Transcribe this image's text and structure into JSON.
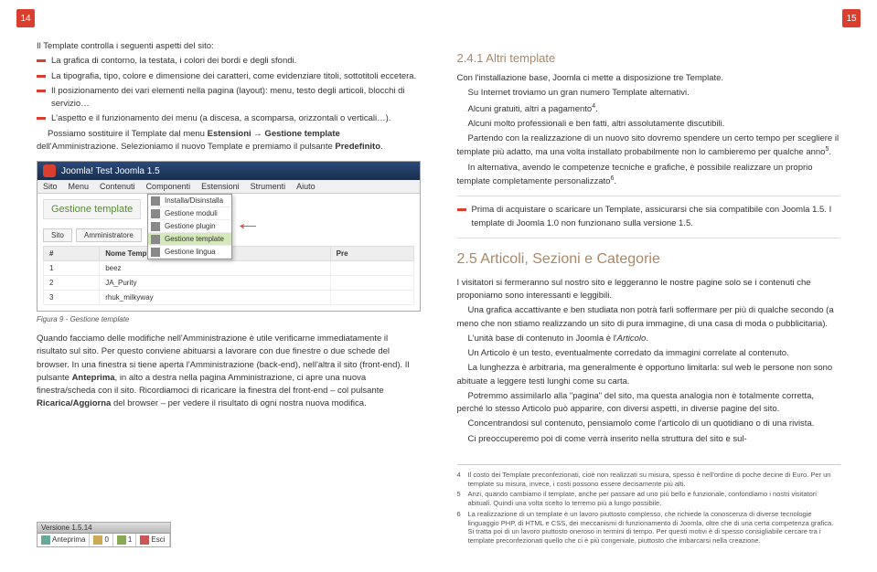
{
  "pageLeft": "14",
  "pageRight": "15",
  "left": {
    "intro": "Il Template controlla i seguenti aspetti del sito:",
    "bullets": [
      "La grafica di contorno, la testata, i colori dei bordi e degli sfondi.",
      "La tipografia, tipo, colore e dimensione dei caratteri, come evidenziare titoli, sottotitoli eccetera.",
      "Il posizionamento dei vari elementi nella pagina (layout): menu, testo degli articoli, blocchi di servizio…",
      "L'aspetto e il funzionamento dei menu (a discesa, a scomparsa, orizzontali o verticali…)."
    ],
    "para1a": "Possiamo sostituire il Template dal menu ",
    "para1b": "Estensioni → Gestione template",
    "para1c": " dell'Amministrazione. Selezioniamo il nuovo Template e premiamo il pulsante ",
    "para1d": "Predefinito",
    "para1e": ".",
    "screenshot": {
      "headerTitle": "Test Joomla 1.5",
      "menu": [
        "Sito",
        "Menu",
        "Contenuti",
        "Componenti",
        "Estensioni",
        "Strumenti",
        "Aiuto"
      ],
      "panelTitle": "Gestione template",
      "dropdown": [
        "Installa/Disinstalla",
        "Gestione moduli",
        "Gestione plugin",
        "Gestione template",
        "Gestione lingua"
      ],
      "tabs": [
        "Sito",
        "Amministratore"
      ],
      "tableHeaders": [
        "#",
        "Nome Template",
        "Pre"
      ],
      "rows": [
        {
          "n": "1",
          "name": "beez"
        },
        {
          "n": "2",
          "name": "JA_Purity"
        },
        {
          "n": "3",
          "name": "rhuk_milkyway"
        }
      ]
    },
    "figcap": "Figura 9 - Gestione template",
    "para2": "Quando facciamo delle modifiche nell'Amministrazione è utile verificarne immediatamente il risultato sul sito. Per questo conviene abituarsi a lavorare con due finestre o due schede del browser. In una finestra si tiene aperta l'Amministrazione (back-end), nell'altra il sito (front-end). Il pulsante ",
    "para2b": "Anteprima",
    "para2c": ", in alto a destra nella pagina Amministrazione, ci apre una nuova finestra/scheda con il sito. Ricordiamoci di ricaricare la finestra del front-end – col pulsante ",
    "para2d": "Ricarica/Aggiorna",
    "para2e": " del browser – per vedere il risultato di ogni nostra nuova modifica.",
    "footerbar": {
      "version": "Versione 1.5.14",
      "items": [
        "Anteprima",
        "0",
        "1",
        "Esci"
      ]
    }
  },
  "right": {
    "h2": "2.4.1 Altri template",
    "p1": "Con l'installazione base, Joomla ci mette a disposizione tre Template.",
    "p2": "Su Internet troviamo un gran numero Template alternativi.",
    "p3a": "Alcuni gratuiti, altri a pagamento",
    "p3b": ".",
    "p4": "Alcuni molto professionali e ben fatti, altri assolutamente discutibili.",
    "p5a": "Partendo con la realizzazione di un nuovo sito dovremo spendere un certo tempo per scegliere il template più adatto, ma una volta installato probabilmente non lo cambieremo per qualche anno",
    "p5b": ".",
    "p6a": "In alternativa, avendo le competenze tecniche e grafiche, è possibile realizzare un proprio template completamente personalizzato",
    "p6b": ".",
    "callout": "Prima di acquistare o scaricare un Template, assicurarsi che sia compatibile con Joomla 1.5. I template di Joomla 1.0 non funzionano sulla versione 1.5.",
    "h3": "2.5 Articoli, Sezioni e Categorie",
    "p7": "I visitatori si fermeranno sul nostro sito e leggeranno le nostre pagine solo se i contenuti che proponiamo sono interessanti e leggibili.",
    "p8": "Una grafica accattivante e ben studiata non potrà farli soffermare per più di qualche secondo (a meno che non stiamo realizzando un sito di pura immagine, di una casa di moda o pubblicitaria).",
    "p9a": "L'unità base di contenuto in Joomla è l'",
    "p9b": "Articolo",
    "p9c": ".",
    "p10": "Un Articolo è un testo, eventualmente corredato da immagini correlate al contenuto.",
    "p11": "La lunghezza è arbitraria, ma generalmente è opportuno limitarla: sul web le persone non sono abituate a leggere testi lunghi come su carta.",
    "p12": "Potremmo assimilarlo alla \"pagina\" del sito, ma questa analogia non è totalmente corretta, perché lo stesso Articolo può apparire, con diversi aspetti, in diverse pagine del sito.",
    "p13": "Concentrandosi sul contenuto, pensiamolo come l'articolo di un quotidiano o di una rivista.",
    "p14": "Ci preoccuperemo poi di come verrà inserito nella struttura del sito e sul-",
    "footnotes": [
      {
        "n": "4",
        "t": "Il costo dei Template preconfezionati, cioè non realizzati su misura, spesso è nell'ordine di poche decine di Euro. Per un template su misura, invece, i costi possono essere decisamente più alti."
      },
      {
        "n": "5",
        "t": "Anzi, quando cambiamo il template, anche per passare ad uno più bello e funzionale, confondiamo i nostri visitatori abituali. Quindi una volta scelto lo terremo più a lungo possibile."
      },
      {
        "n": "6",
        "t": "La realizzazione di un template è un lavoro piuttosto complesso, che richiede la conoscenza di diverse tecnologie linguaggio PHP, di HTML e CSS, dei meccanismi di funzionamento di Joomla, oltre che di una certa competenza grafica. Si tratta poi di un lavoro piuttosto oneroso in termini di tempo. Per questi motivi è di spesso consigliabile cercare tra i template preconfezionati quello che ci è più congeniale, piuttosto che imbarcarsi nella creazione."
      }
    ]
  }
}
